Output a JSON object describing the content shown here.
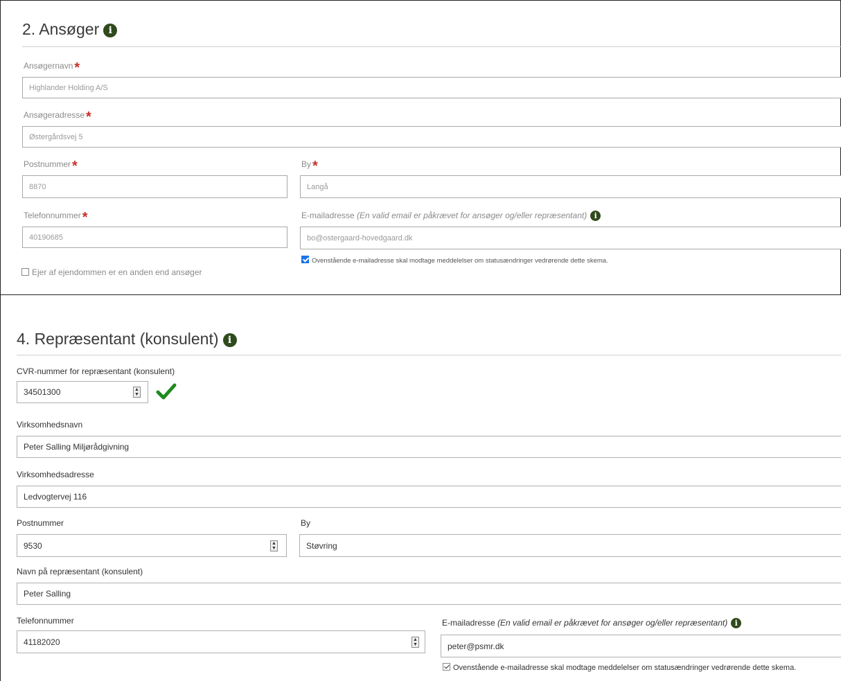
{
  "ansoeger": {
    "title": "2. Ansøger",
    "navn_label": "Ansøgernavn",
    "navn_value": "Highlander Holding A/S",
    "adresse_label": "Ansøgeradresse",
    "adresse_value": "Østergårdsvej 5",
    "postnummer_label": "Postnummer",
    "postnummer_value": "8870",
    "by_label": "By",
    "by_value": "Langå",
    "telefon_label": "Telefonnummer",
    "telefon_value": "40190685",
    "email_label": "E-mailadresse",
    "email_hint": "(En valid email er påkrævet for ansøger og/eller repræsentant)",
    "email_value": "bo@ostergaard-hovedgaard.dk",
    "email_notify_label": "Ovenstående e-mailadresse skal modtage meddelelser om statusændringer vedrørende dette skema.",
    "email_notify_checked": true,
    "ejer_label": "Ejer af ejendommen er en anden end ansøger",
    "ejer_checked": false
  },
  "repraesentant": {
    "title": "4. Repræsentant (konsulent)",
    "cvr_label": "CVR-nummer for repræsentant (konsulent)",
    "cvr_value": "34501300",
    "virksomhed_label": "Virksomhedsnavn",
    "virksomhed_value": "Peter Salling Miljørådgivning",
    "adresse_label": "Virksomhedsadresse",
    "adresse_value": "Ledvogtervej 116",
    "postnummer_label": "Postnummer",
    "postnummer_value": "9530",
    "by_label": "By",
    "by_value": "Støvring",
    "navn_label": "Navn på repræsentant (konsulent)",
    "navn_value": "Peter Salling",
    "telefon_label": "Telefonnummer",
    "telefon_value": "41182020",
    "email_label": "E-mailadresse",
    "email_hint": "(En valid email er påkrævet for ansøger og/eller repræsentant)",
    "email_value": "peter@psmr.dk",
    "email_notify_label": "Ovenstående e-mailadresse skal modtage meddelelser om statusændringer vedrørende dette skema.",
    "email_notify_checked": true
  },
  "icons": {
    "info": "info-circle-icon",
    "valid": "checkmark-icon",
    "required": "asterisk-icon"
  },
  "colors": {
    "required": "#c9302c",
    "info_icon": "#2f4a1c",
    "valid_check": "#1f8a1f",
    "checkbox_checked": "#1a73e8"
  }
}
